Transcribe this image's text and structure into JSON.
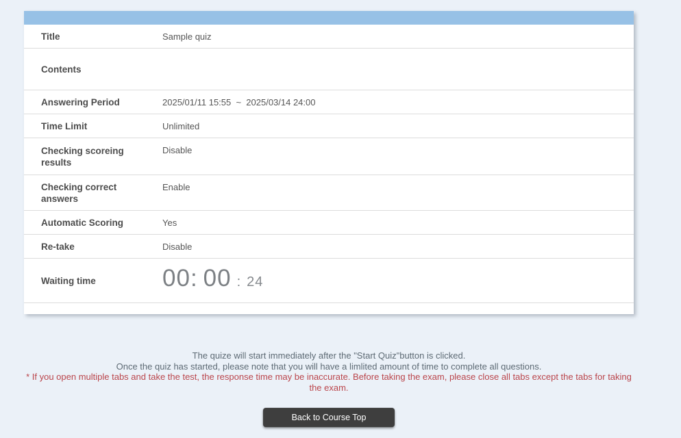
{
  "page": {
    "background_color": "#ebf1f8",
    "header_bar_color": "#97c1e6",
    "warning_color": "#ba454b",
    "button_color": "#3e3e3e"
  },
  "table": {
    "rows": [
      {
        "label": "Title",
        "value": "Sample quiz"
      },
      {
        "label": "Contents",
        "value": ""
      },
      {
        "label": "Answering Period",
        "value": "2025/01/11 15:55  ~  2025/03/14 24:00"
      },
      {
        "label": "Time Limit",
        "value": "Unlimited"
      },
      {
        "label": "Checking scoreing results",
        "value": "Disable"
      },
      {
        "label": "Checking correct answers",
        "value": "Enable"
      },
      {
        "label": "Automatic Scoring",
        "value": "Yes"
      },
      {
        "label": "Re-take",
        "value": "Disable"
      },
      {
        "label": "Waiting time"
      }
    ]
  },
  "timer": {
    "part1": "00",
    "part2": "00",
    "part3": "24",
    "sep": ":"
  },
  "footer": {
    "line1": "The quize will start immediately after the \"Start Quiz\"button is clicked.",
    "line2": "Once the quiz has started, please note that you will have a limlited amount of time to complete all questions.",
    "warning": "* If you open multiple tabs and take the test, the response time may be inaccurate. Before taking the exam, please close all tabs except the tabs for taking the exam."
  },
  "button": {
    "label": "Back to Course Top"
  }
}
